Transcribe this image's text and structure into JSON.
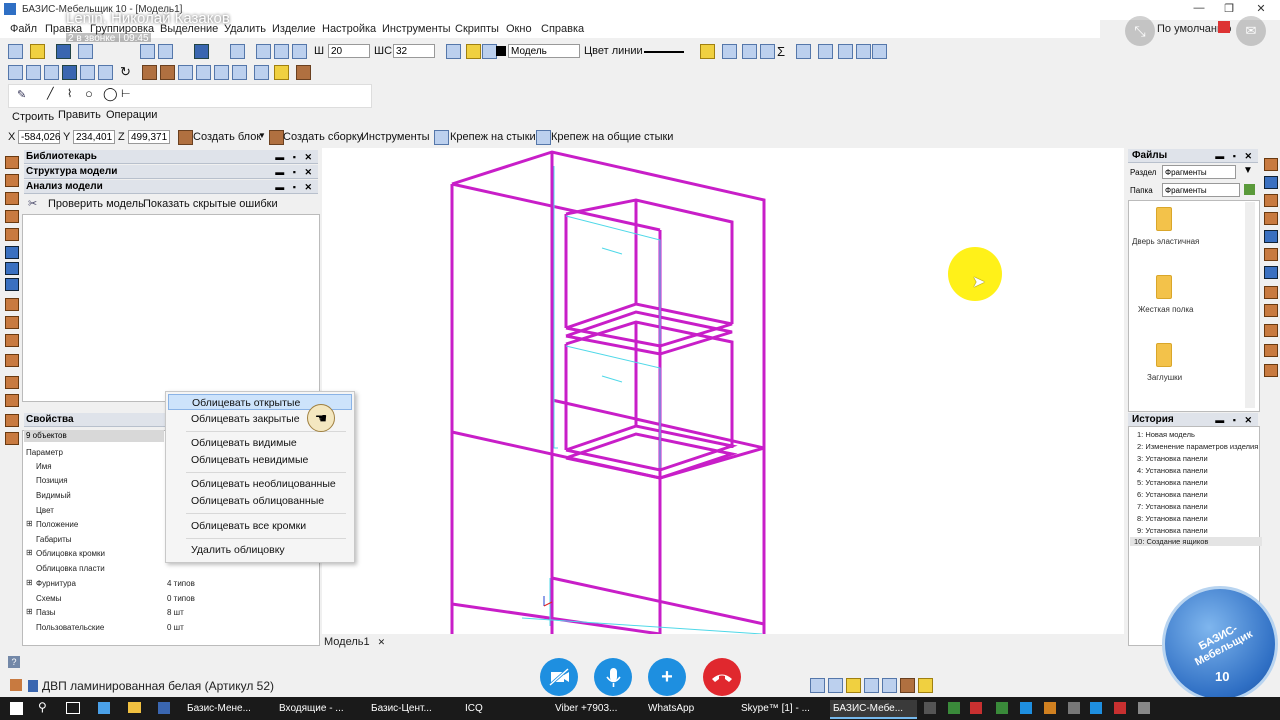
{
  "window": {
    "title": "БАЗИС-Мебельщик 10 - [Модель1]",
    "controls": [
      "—",
      "❐",
      "✕"
    ]
  },
  "call": {
    "name": "Lenin, Николай Казаков",
    "status": "2 в звонке | 09:45",
    "view_mode": "По умолчанию",
    "buttons": {
      "video_off": "video-off",
      "mic": "mic",
      "add": "+",
      "hangup": "hangup"
    }
  },
  "menu": [
    "Файл",
    "Правка",
    "Группировка",
    "Выделение",
    "Удалить",
    "Изделие",
    "Настройка",
    "Инструменты",
    "Скрипты",
    "Окно",
    "Справка"
  ],
  "toolbar": {
    "w_label": "Ш",
    "w_value": "20",
    "hs_label": "ШС",
    "hs_value": "32",
    "layer_value": "Модель",
    "line_color_label": "Цвет линии"
  },
  "tabs": [
    "Строить",
    "Править",
    "Операции"
  ],
  "coords": {
    "x_label": "X",
    "x": "-584,026",
    "y_label": "Y",
    "y": "234,401",
    "z_label": "Z",
    "z": "499,371"
  },
  "actions": {
    "create_block": "Создать блок",
    "create_assembly": "Создать сборку",
    "tools": "Инструменты",
    "joint_fix": "Крепеж на стыки",
    "common_joint_fix": "Крепеж на общие стыки"
  },
  "left_panels": {
    "librarian": "Библиотекарь",
    "structure": "Структура модели",
    "analysis": "Анализ модели",
    "check_model": "Проверить модель",
    "show_hidden": "Показать скрытые ошибки",
    "panel_controls": "▬ ▪ ✕"
  },
  "properties": {
    "title": "Свойства",
    "count": "9 объектов",
    "rows": [
      {
        "name": "Параметр",
        "value": ""
      },
      {
        "name": "Имя",
        "value": ""
      },
      {
        "name": "Позиция",
        "value": ""
      },
      {
        "name": "Видимый",
        "value": ""
      },
      {
        "name": "Цвет",
        "value": ""
      },
      {
        "name": "Положение",
        "value": ""
      },
      {
        "name": "Габариты",
        "value": ""
      },
      {
        "name": "Облицовка кромки",
        "value": ""
      },
      {
        "name": "Облицовка пласти",
        "value": ""
      },
      {
        "name": "Фурнитура",
        "value": "4 типов"
      },
      {
        "name": "Схемы",
        "value": "0 типов"
      },
      {
        "name": "Пазы",
        "value": "8 шт"
      },
      {
        "name": "Пользовательские",
        "value": "0 шт"
      }
    ]
  },
  "context_menu": [
    "Облицевать открытые",
    "Облицевать закрытые",
    "Облицевать видимые",
    "Облицевать невидимые",
    "Облицевать необлицованные",
    "Облицевать облицованные",
    "Облицевать все кромки",
    "Удалить облицовку"
  ],
  "canvas": {
    "tab": "Модель1",
    "tab_close": "✕"
  },
  "files": {
    "title": "Файлы",
    "section_label": "Раздел",
    "section_value": "Фрагменты",
    "folder_label": "Папка",
    "folder_value": "Фрагменты",
    "items": [
      "Дверь эластичная",
      "Жесткая полка",
      "Заглушки"
    ]
  },
  "history": {
    "title": "История",
    "items": [
      "1: Новая модель",
      "2: Изменение параметров изделия",
      "3: Установка панели",
      "4: Установка панели",
      "5: Установка панели",
      "6: Установка панели",
      "7: Установка панели",
      "8: Установка панели",
      "9: Установка панели",
      "10: Создание ящиков"
    ]
  },
  "status": {
    "material": "ДВП ламинированная белая (Артикул 52)"
  },
  "badge": {
    "text": "БАЗИС-Мебельщик",
    "number": "10"
  },
  "taskbar": [
    "Базис-Мене...",
    "Входящие - ...",
    "Базис-Цент...",
    "ICQ",
    "Viber +7903...",
    "WhatsApp",
    "Skype™ [1] - ...",
    "БАЗИС-Мебе..."
  ],
  "colors": {
    "model_lines": "#c81ec8",
    "highlight": "#cde3fb",
    "cursor_halo": "#fff000",
    "hangup": "#e0282e",
    "call_blue": "#1e8fe0"
  }
}
